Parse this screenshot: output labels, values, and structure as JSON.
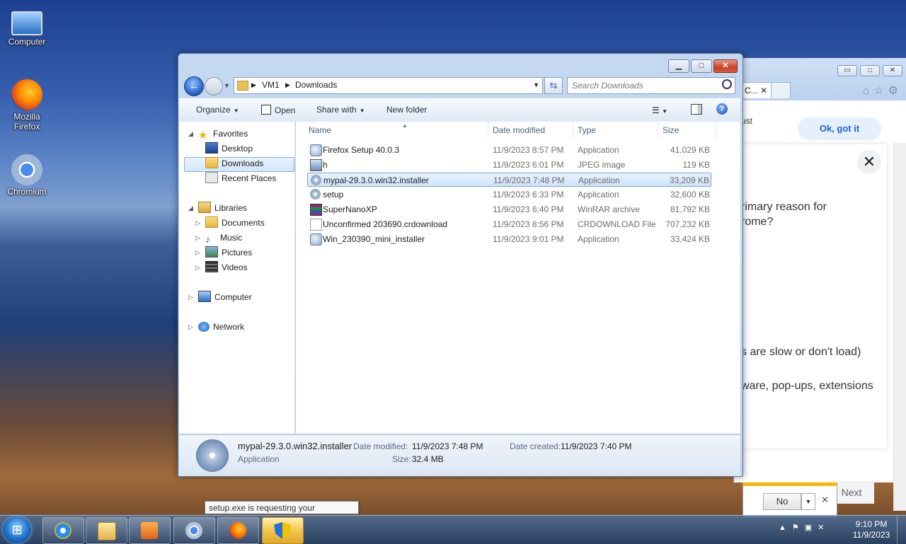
{
  "desktop": {
    "icons": [
      {
        "label": "Computer"
      },
      {
        "label": "Mozilla\nFirefox"
      },
      {
        "label": "Chromium"
      }
    ]
  },
  "background_window": {
    "tab_label": "C...",
    "got_it": "Ok, got it",
    "text_just": "ust",
    "text_q1": "rimary reason for",
    "text_q2": "rome?",
    "text_opt1": "s are slow or don't load)",
    "text_opt2": "ware, pop-ups, extensions",
    "next": "Next",
    "no": "No"
  },
  "explorer": {
    "breadcrumb": [
      "VM1",
      "Downloads"
    ],
    "search_placeholder": "Search Downloads",
    "toolbar": {
      "organize": "Organize",
      "open": "Open",
      "share_with": "Share with",
      "new_folder": "New folder"
    },
    "nav": {
      "favorites": "Favorites",
      "desktop": "Desktop",
      "downloads": "Downloads",
      "recent_places": "Recent Places",
      "libraries": "Libraries",
      "documents": "Documents",
      "music": "Music",
      "pictures": "Pictures",
      "videos": "Videos",
      "computer": "Computer",
      "network": "Network"
    },
    "columns": {
      "name": "Name",
      "date": "Date modified",
      "type": "Type",
      "size": "Size"
    },
    "files": [
      {
        "name": "Firefox Setup 40.0.3",
        "date": "11/9/2023 8:57 PM",
        "type": "Application",
        "size": "41,029 KB",
        "icon": "app-icon"
      },
      {
        "name": "h",
        "date": "11/9/2023 6:01 PM",
        "type": "JPEG image",
        "size": "119 KB",
        "icon": "image-icon"
      },
      {
        "name": "mypal-29.3.0.win32.installer",
        "date": "11/9/2023 7:48 PM",
        "type": "Application",
        "size": "33,209 KB",
        "icon": "installer-icon",
        "selected": true
      },
      {
        "name": "setup",
        "date": "11/9/2023 6:33 PM",
        "type": "Application",
        "size": "32,600 KB",
        "icon": "installer-icon"
      },
      {
        "name": "SuperNanoXP",
        "date": "11/9/2023 6:40 PM",
        "type": "WinRAR archive",
        "size": "81,792 KB",
        "icon": "winrar-icon"
      },
      {
        "name": "Unconfirmed 203690.crdownload",
        "date": "11/9/2023 8:56 PM",
        "type": "CRDOWNLOAD File",
        "size": "707,232 KB",
        "icon": "blank-file-icon"
      },
      {
        "name": "Win_230390_mini_installer",
        "date": "11/9/2023 9:01 PM",
        "type": "Application",
        "size": "33,424 KB",
        "icon": "app-icon"
      }
    ],
    "details": {
      "name": "mypal-29.3.0.win32.installer",
      "kind": "Application",
      "date_modified_label": "Date modified:",
      "date_modified": "11/9/2023 7:48 PM",
      "size_label": "Size:",
      "size": "32.4 MB",
      "date_created_label": "Date created:",
      "date_created": "11/9/2023 7:40 PM"
    }
  },
  "tooltip": "setup.exe is requesting your permission",
  "taskbar": {
    "time": "9:10 PM",
    "date": "11/9/2023"
  }
}
